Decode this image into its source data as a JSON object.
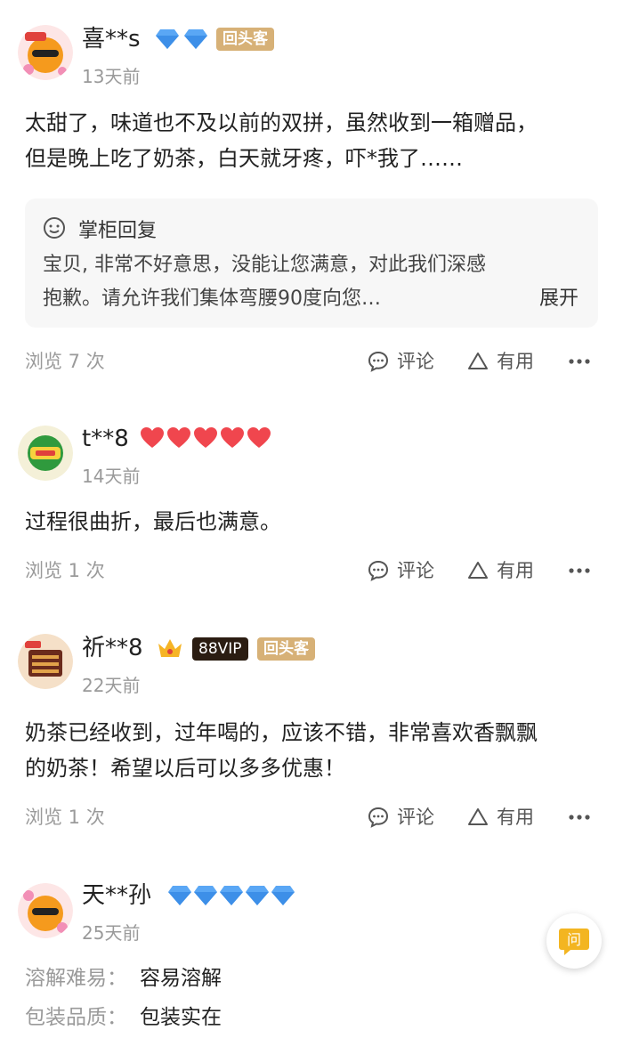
{
  "reviews": [
    {
      "user": "喜**s",
      "tags": [
        "回头客"
      ],
      "date": "13天前",
      "content_lines": [
        "太甜了，味道也不及以前的双拼，虽然收到一箱赠品，",
        "但是晚上吃了奶茶，白天就牙疼，吓*我了……"
      ],
      "reply": {
        "title": "掌柜回复",
        "lines": [
          "宝贝, 非常不好意思，没能让您满意，对此我们深感",
          "抱歉。请允许我们集体弯腰90度向您…"
        ],
        "expand": "展开"
      },
      "views": "浏览 7 次",
      "comment": "评论",
      "useful": "有用"
    },
    {
      "user": "t**8",
      "date": "14天前",
      "content_lines": [
        "过程很曲折，最后也满意。"
      ],
      "views": "浏览 1 次",
      "comment": "评论",
      "useful": "有用"
    },
    {
      "user": "祈**8",
      "tags": [
        "88VIP",
        "回头客"
      ],
      "date": "22天前",
      "content_lines": [
        "奶茶已经收到，过年喝的，应该不错，非常喜欢香飘飘",
        "的奶茶！希望以后可以多多优惠！"
      ],
      "views": "浏览 1 次",
      "comment": "评论",
      "useful": "有用"
    },
    {
      "user": "天**孙",
      "date": "25天前",
      "details": [
        {
          "key": "溶解难易：",
          "value": "容易溶解"
        },
        {
          "key": "包装品质：",
          "value": "包装实在"
        }
      ]
    }
  ],
  "ask_button": "问",
  "colors": {
    "diamond": "#5aa7f5",
    "heart": "#f0464e",
    "tag_return": "#d7b177",
    "tag_vip_bg": "#2b1d12",
    "ask_yellow": "#f3b521"
  }
}
